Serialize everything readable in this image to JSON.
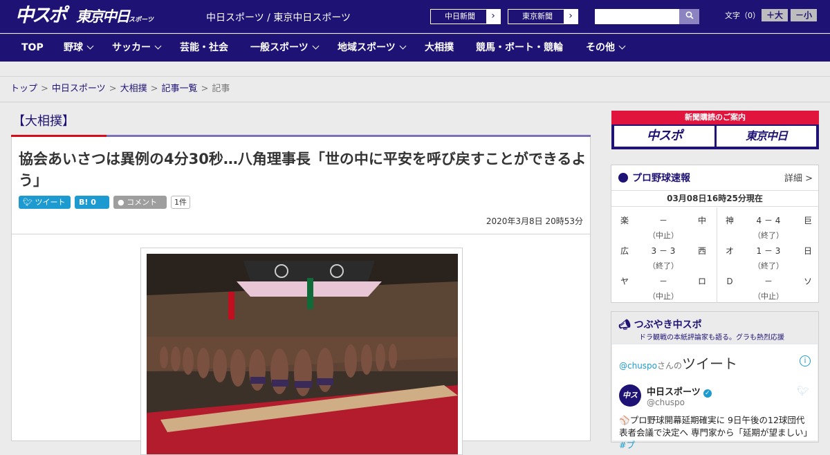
{
  "header": {
    "logo_chuspo": "中スポ",
    "logo_tokyo": "東京中日",
    "logo_tokyo_small": "スポーツ",
    "site_name": "中日スポーツ / 東京中日スポーツ",
    "paper_links": [
      "中日新聞",
      "東京新聞"
    ],
    "search": {
      "value": "",
      "placeholder": ""
    },
    "font_size_label": "文字（0）",
    "font_larger": "＋大",
    "font_smaller": "－小"
  },
  "nav": {
    "items": [
      {
        "label": "TOP",
        "dropdown": false
      },
      {
        "label": "野球",
        "dropdown": true
      },
      {
        "label": "サッカー",
        "dropdown": true
      },
      {
        "label": "芸能・社会",
        "dropdown": false
      },
      {
        "label": "一般スポーツ",
        "dropdown": true
      },
      {
        "label": "地域スポーツ",
        "dropdown": true
      },
      {
        "label": "大相撲",
        "dropdown": false
      },
      {
        "label": "競馬・ボート・競輪",
        "dropdown": false
      },
      {
        "label": "その他",
        "dropdown": true
      }
    ]
  },
  "breadcrumb": {
    "items": [
      "トップ",
      "中日スポーツ",
      "大相撲",
      "記事一覧"
    ],
    "current": "記事"
  },
  "article": {
    "category": "【大相撲】",
    "headline": "協会あいさつは異例の4分30秒…八角理事長「世の中に平安を呼び戻すことができるよう」",
    "share_tweet": "ツイート",
    "share_hatena": "B! 0",
    "share_comment": "コメント",
    "comment_count": "1件",
    "date": "2020年3月8日 20時53分"
  },
  "sidebar": {
    "promo_title": "新聞購読のご案内",
    "promo_chuspo": "中スポ",
    "promo_tokyo": "東京中日",
    "baseball": {
      "title": "プロ野球速報",
      "detail": "詳細 >",
      "updated": "03月08日16時25分現在",
      "games": [
        {
          "home": "楽",
          "score": "－",
          "away": "中",
          "status": "（中止）"
        },
        {
          "home": "神",
          "score": "4 － 4",
          "away": "巨",
          "status": "（終了）"
        },
        {
          "home": "広",
          "score": "3 － 3",
          "away": "西",
          "status": "（終了）"
        },
        {
          "home": "オ",
          "score": "1 － 3",
          "away": "日",
          "status": "（終了）"
        },
        {
          "home": "ヤ",
          "score": "－",
          "away": "ロ",
          "status": "（中止）"
        },
        {
          "home": "Ｄ",
          "score": "－",
          "away": "ソ",
          "status": "（中止）"
        }
      ]
    },
    "twitter": {
      "title": "つぶやき中スポ",
      "subtitle": "ドラ観戦の本紙評論家も語る。グラも熱烈応援",
      "handle": "@chuspo",
      "handle_suffix": "さんの",
      "tweets_label": "ツイート",
      "account_name": "中日スポーツ",
      "account_id": "@chuspo",
      "avatar_text": "中スポ",
      "tweet_text": "⚾プロ野球開幕延期確実に 9日午後の12球団代表者会議で決定へ 専門家から「延期が望ましい」",
      "tweet_tag": "#プ"
    }
  },
  "colors": {
    "brand": "#1e1275",
    "accent_red": "#d70c18",
    "twitter_blue": "#1d9bd1"
  }
}
